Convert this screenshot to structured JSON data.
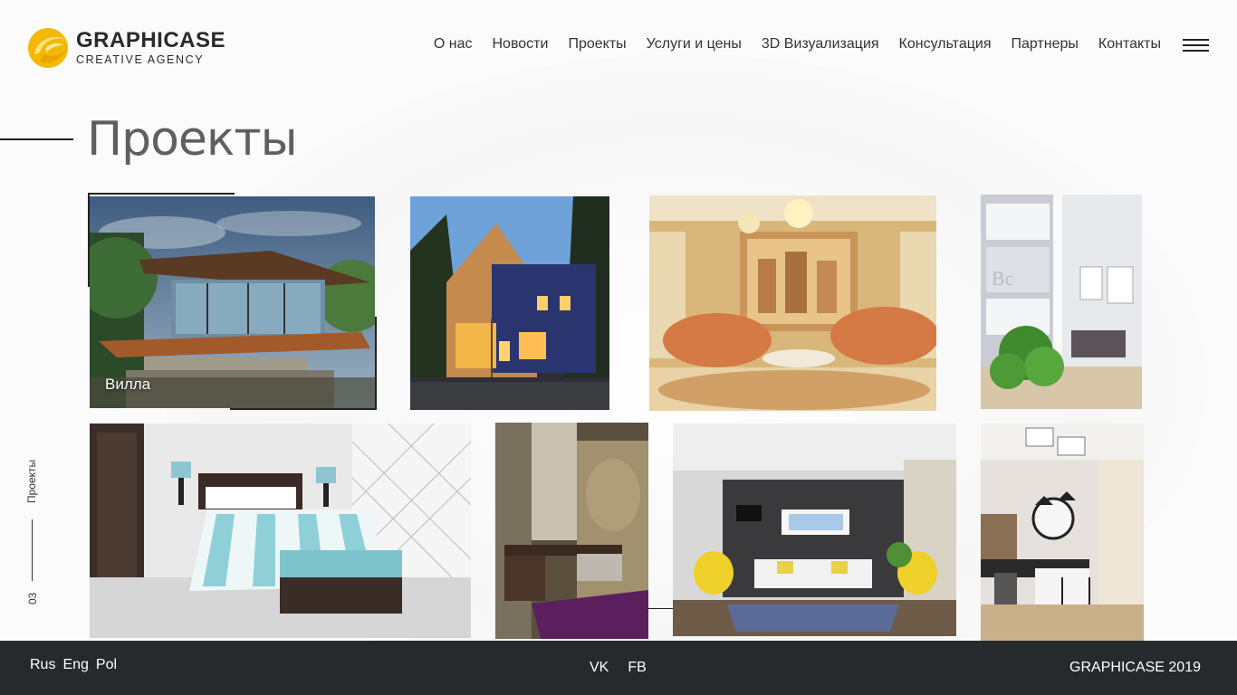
{
  "logo": {
    "name": "GRAPHICASE",
    "subtitle": "CREATIVE AGENCY",
    "colors": {
      "primary": "#f5b800",
      "secondary": "#ffd84a"
    }
  },
  "nav": [
    {
      "label": "О нас"
    },
    {
      "label": "Новости"
    },
    {
      "label": "Проекты"
    },
    {
      "label": "Услуги и цены"
    },
    {
      "label": "3D Визуализация"
    },
    {
      "label": "Консультация"
    },
    {
      "label": "Партнеры"
    },
    {
      "label": "Контакты"
    }
  ],
  "menu_icon": "hamburger-icon",
  "page": {
    "title": "Проекты",
    "side_label": "Проекты",
    "side_number": "03"
  },
  "projects": [
    {
      "id": "villa",
      "caption": "Вилла",
      "scene": "modern villa with glass walls on wooden deck"
    },
    {
      "id": "wood-house",
      "caption": "",
      "scene": "wood and dark blue facade house at dusk"
    },
    {
      "id": "classic-living",
      "caption": "",
      "scene": "classic living room with Venice mural"
    },
    {
      "id": "hall-shelves",
      "caption": "",
      "scene": "white hallway with shelves and plant"
    },
    {
      "id": "bedroom",
      "caption": "",
      "scene": "bedroom with striped bedding and lattice screen"
    },
    {
      "id": "bathroom",
      "caption": "",
      "scene": "stone bathroom with purple bed"
    },
    {
      "id": "living-yellow",
      "caption": "",
      "scene": "living room with yellow chairs"
    },
    {
      "id": "kitchen",
      "caption": "",
      "scene": "kitchen with clock and bar stools"
    }
  ],
  "footer": {
    "languages": [
      "Rus",
      "Eng",
      "Pol"
    ],
    "socials": [
      "VK",
      "FB"
    ],
    "copyright": "GRAPHICASE 2019",
    "background": "#262a2d"
  }
}
